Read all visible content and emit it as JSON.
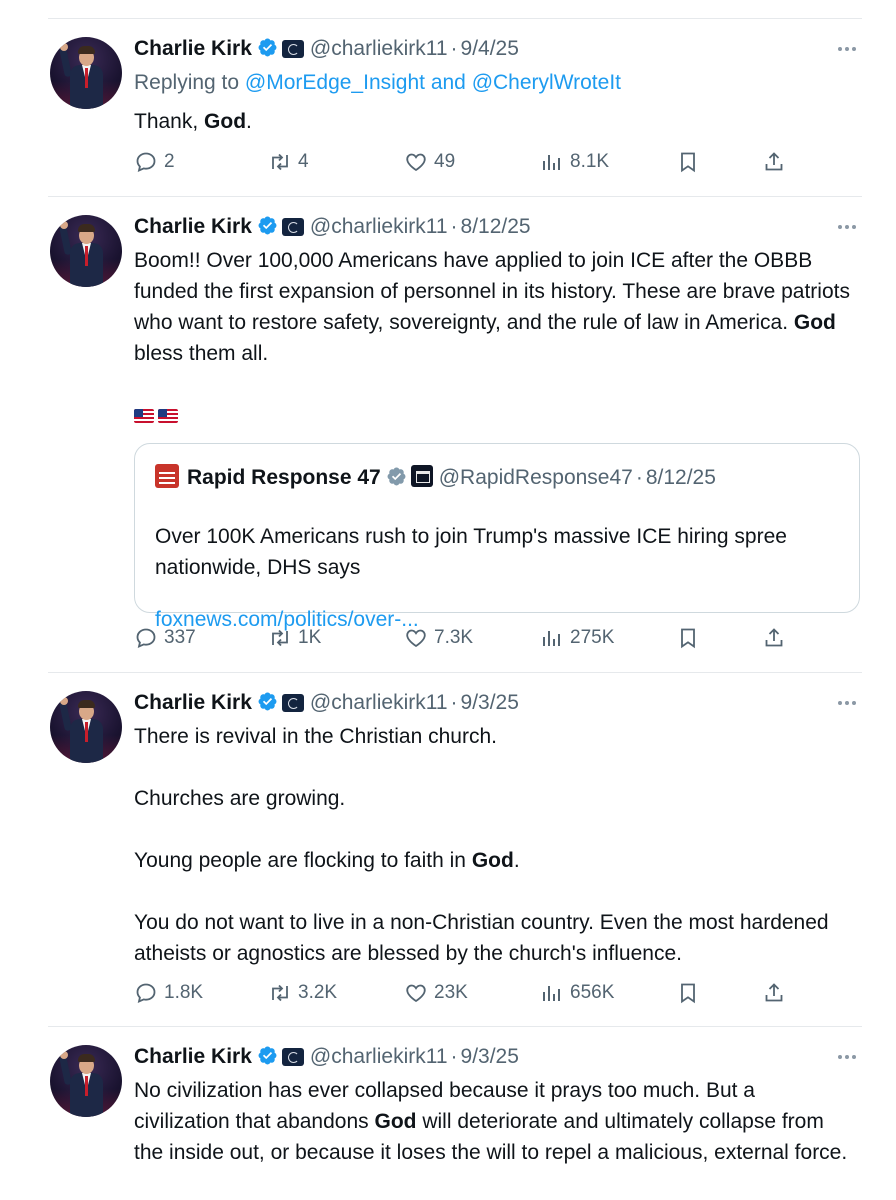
{
  "tweets": [
    {
      "name": "Charlie Kirk",
      "handle": "@charliekirk11",
      "date": "9/4/25",
      "replying_prefix": "Replying to ",
      "replying_to": "@MorEdge_Insight and @CherylWroteIt",
      "text_parts": [
        "Thank, ",
        "God",
        "."
      ],
      "stats": {
        "replies": "2",
        "reposts": "4",
        "likes": "49",
        "views": "8.1K"
      }
    },
    {
      "name": "Charlie Kirk",
      "handle": "@charliekirk11",
      "date": "8/12/25",
      "text_parts": [
        "Boom!! Over 100,000 Americans have applied to join ICE after the OBBB funded the first expansion of personnel in its history. These are brave patriots who want to restore safety, sovereignty, and the rule of law in America. ",
        "God",
        " bless them all."
      ],
      "flags": "🇺🇸🇺🇸",
      "quote": {
        "name": "Rapid Response 47",
        "handle": "@RapidResponse47",
        "date": "8/12/25",
        "text": "Over 100K Americans rush to join Trump's massive ICE hiring spree nationwide, DHS says",
        "link": "foxnews.com/politics/over-..."
      },
      "stats": {
        "replies": "337",
        "reposts": "1K",
        "likes": "7.3K",
        "views": "275K"
      }
    },
    {
      "name": "Charlie Kirk",
      "handle": "@charliekirk11",
      "date": "9/3/25",
      "para1": "There is revival in the Christian church.",
      "para2": "Churches are growing.",
      "para3_parts": [
        "Young people are flocking to faith in ",
        "God",
        "."
      ],
      "para4": "You do not want to live in a non-Christian country. Even the most hardened atheists or agnostics are blessed by the church's influence.",
      "stats": {
        "replies": "1.8K",
        "reposts": "3.2K",
        "likes": "23K",
        "views": "656K"
      }
    },
    {
      "name": "Charlie Kirk",
      "handle": "@charliekirk11",
      "date": "9/3/25",
      "text_parts": [
        "No civilization has ever collapsed because it prays too much. But a civilization that abandons ",
        "God",
        " will deteriorate and ultimately collapse from the inside out, or because it loses the will to repel a malicious, external force."
      ]
    }
  ],
  "separator": "·",
  "icons": [
    "reply-icon",
    "repost-icon",
    "like-icon",
    "views-icon",
    "bookmark-icon",
    "share-icon",
    "verified-badge-icon",
    "more-options-icon"
  ],
  "colors": {
    "verified": "#1d9bf0",
    "link": "#1d9bf0",
    "muted": "#536471",
    "text": "#0f1419"
  }
}
